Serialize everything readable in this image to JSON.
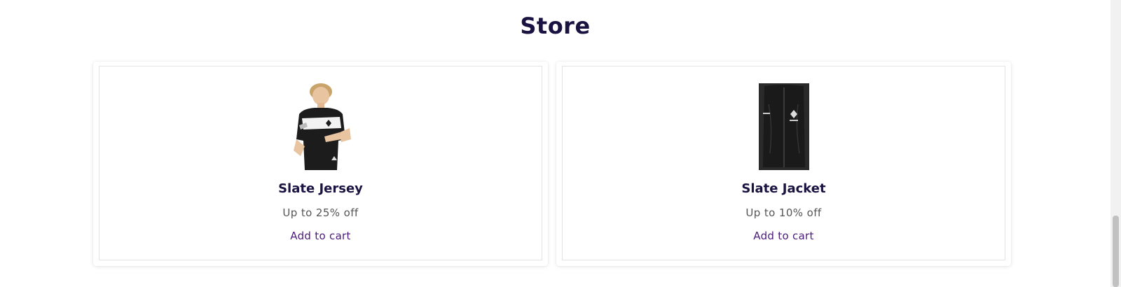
{
  "store": {
    "title": "Store",
    "products": [
      {
        "name": "Slate Jersey",
        "discount": "Up to 25% off",
        "cta": "Add to cart",
        "image_icon": "jersey-photo"
      },
      {
        "name": "Slate Jacket",
        "discount": "Up to 10% off",
        "cta": "Add to cart",
        "image_icon": "jacket-photo"
      }
    ]
  },
  "colors": {
    "title": "#1a1240",
    "discount": "#555555",
    "cta": "#4b1a7a",
    "card_border": "#e3e3e3"
  },
  "scroll": {
    "position_fraction": 0.75
  }
}
